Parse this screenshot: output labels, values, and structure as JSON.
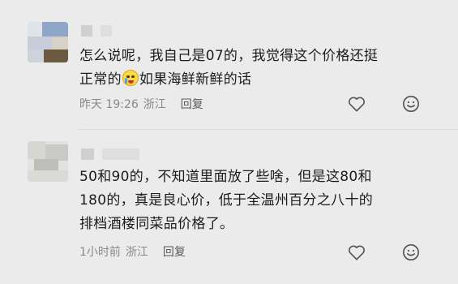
{
  "comments": [
    {
      "text_lines": [
        "怎么说呢，我自己是07的，我觉得这个价格还挺",
        "正常的",
        "如果海鲜新鲜的话"
      ],
      "time": "昨天 19:26",
      "location": "浙江",
      "reply_label": "回复"
    },
    {
      "text_lines": [
        "50和90的，不知道里面放了些啥，但是这80和",
        "180的，真是良心价，低于全温州百分之八十的",
        "排档酒楼同菜品价格了。"
      ],
      "time": "1小时前",
      "location": "浙江",
      "reply_label": "回复"
    }
  ],
  "icons": {
    "like": "heart-outline-icon",
    "emoji": "smiley-outline-icon",
    "inline_emoji": "crying-laughing-emoji"
  },
  "colors": {
    "background": "#ebebeb",
    "text": "#1c1c1c",
    "meta": "#8a8a8a"
  }
}
